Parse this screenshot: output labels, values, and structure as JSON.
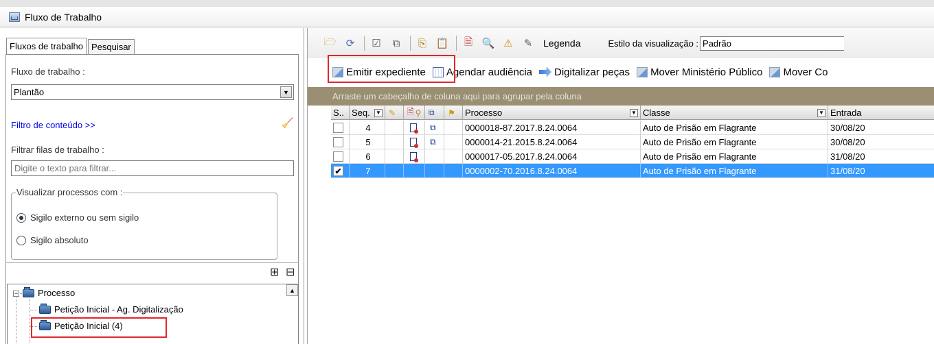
{
  "window": {
    "title": "Fluxo de Trabalho"
  },
  "left": {
    "tabs": [
      "Fluxos de trabalho",
      "Pesquisar"
    ],
    "workflow_label": "Fluxo de trabalho :",
    "workflow_value": "Plantão",
    "content_filter_link": "Filtro de conteúdo >>",
    "filter_queues_label": "Filtrar filas de trabalho :",
    "filter_placeholder": "Digite o texto para filtrar...",
    "visualize_legend": "Visualizar processos com :",
    "radio_external": "Sigilo externo ou sem sigilo",
    "radio_absolute": "Sigilo absoluto",
    "tree": {
      "root": "Processo",
      "child1": "Petição Inicial - Ag. Digitalização",
      "child2": "Petição Inicial (4)"
    }
  },
  "toolbar": {
    "legend_label": "Legenda",
    "style_label": "Estilo da visualização :",
    "style_value": "Padrão",
    "actions": {
      "emitir": "Emitir expediente",
      "agendar": "Agendar audiência",
      "digitalizar": "Digitalizar peças",
      "mover_mp": "Mover Ministério Público",
      "mover_co": "Mover Co"
    }
  },
  "grid": {
    "group_hint": "Arraste um cabeçalho de coluna aqui para agrupar pela coluna",
    "headers": {
      "s": "S..",
      "seq": "Seq.",
      "processo": "Processo",
      "classe": "Classe",
      "entrada": "Entrada"
    },
    "rows": [
      {
        "seq": "4",
        "processo": "0000018-87.2017.8.24.0064",
        "classe": "Auto de Prisão em Flagrante",
        "entrada": "30/08/20",
        "checked": false,
        "doc": true,
        "link": true,
        "selected": false
      },
      {
        "seq": "5",
        "processo": "0000014-21.2015.8.24.0064",
        "classe": "Auto de Prisão em Flagrante",
        "entrada": "30/08/20",
        "checked": false,
        "doc": true,
        "link": true,
        "selected": false
      },
      {
        "seq": "6",
        "processo": "0000017-05.2017.8.24.0064",
        "classe": "Auto de Prisão em Flagrante",
        "entrada": "31/08/20",
        "checked": false,
        "doc": true,
        "link": false,
        "selected": false
      },
      {
        "seq": "7",
        "processo": "0000002-70.2016.8.24.0064",
        "classe": "Auto de Prisão em Flagrante",
        "entrada": "31/08/20",
        "checked": true,
        "doc": false,
        "link": false,
        "selected": true
      }
    ]
  },
  "colors": {
    "highlight_box": "#e0262b",
    "group_bar": "#9a8f73",
    "selection": "#3399ff",
    "link": "#0000ee"
  }
}
